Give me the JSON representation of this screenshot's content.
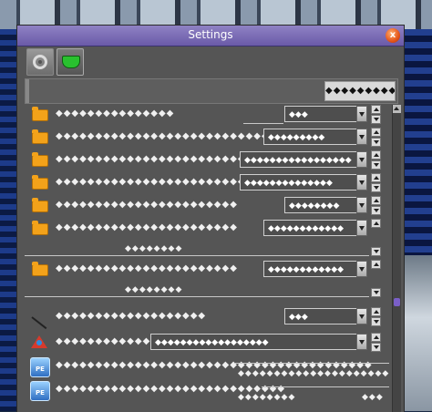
{
  "window": {
    "title": "Settings",
    "close_label": "x"
  },
  "header": {
    "button_label": "◆◆◆◆◆◆◆◆◆◆◆◆"
  },
  "rows": [
    {
      "label": "◆◆◆◆◆◆◆◆◆◆◆◆◆◆◆",
      "value": "◆◆◆",
      "icon": "folder-icon"
    },
    {
      "label": "◆◆◆◆◆◆◆◆◆◆◆◆◆◆◆◆◆◆◆◆◆◆◆◆◆◆◆",
      "value": "◆◆◆◆◆◆◆◆◆",
      "icon": "folder-icon"
    },
    {
      "label": "◆◆◆◆◆◆◆◆◆◆◆◆◆◆◆◆◆◆◆◆◆◆◆◆◆◆◆◆◆",
      "value": "◆◆◆◆◆◆◆◆◆◆◆◆◆◆◆◆◆",
      "icon": "folder-icon"
    },
    {
      "label": "◆◆◆◆◆◆◆◆◆◆◆◆◆◆◆◆◆◆◆◆◆◆◆◆◆◆◆",
      "value": "◆◆◆◆◆◆◆◆◆◆◆◆◆◆",
      "icon": "folder-icon"
    },
    {
      "label": "◆◆◆◆◆◆◆◆◆◆◆◆◆◆◆◆◆◆◆◆◆◆◆",
      "value": "◆◆◆◆◆◆◆◆",
      "icon": "folder-icon"
    },
    {
      "label": "◆◆◆◆◆◆◆◆◆◆◆◆◆◆◆◆◆◆◆◆◆◆◆",
      "value": "◆◆◆◆◆◆◆◆◆◆◆◆",
      "sub": "◆◆◆◆◆◆◆◆",
      "icon": "folder-icon"
    },
    {
      "label": "◆◆◆◆◆◆◆◆◆◆◆◆◆◆◆◆◆◆◆◆◆◆◆",
      "value": "◆◆◆◆◆◆◆◆◆◆◆◆",
      "sub": "◆◆◆◆◆◆◆◆",
      "icon": "folder-icon"
    },
    {
      "label": "◆◆◆◆◆◆◆◆◆◆◆◆◆◆◆◆◆◆◆",
      "value": "◆◆◆",
      "icon": "pen-icon"
    },
    {
      "label": "◆◆◆◆◆◆◆◆◆◆◆◆◆◆◆◆◆◆◆◆◆◆◆◆◆◆◆◆◆◆",
      "value": "◆◆◆◆◆◆◆◆◆◆◆◆◆◆◆◆◆◆",
      "icon": "shapes-icon"
    },
    {
      "label": "◆◆◆◆◆◆◆◆◆◆◆◆◆◆◆◆◆◆◆◆◆◆◆◆◆◆◆◆◆◆◆◆◆◆◆◆◆◆◆◆",
      "sub": "◆◆◆◆◆◆◆◆◆◆◆◆◆◆◆◆◆◆◆◆◆",
      "icon": "pe-icon"
    },
    {
      "label": "◆◆◆◆◆◆◆◆◆◆◆◆◆◆◆◆◆◆◆◆◆◆◆◆◆◆◆◆◆",
      "sub": "◆◆◆◆◆◆◆◆",
      "sub2": "◆◆◆",
      "icon": "pe-icon"
    }
  ]
}
